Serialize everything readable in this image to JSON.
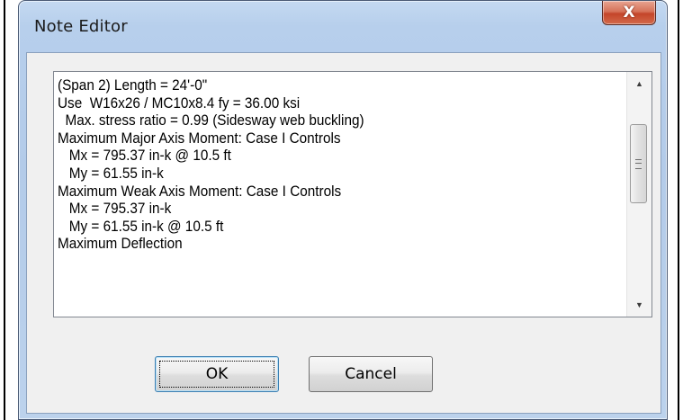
{
  "window": {
    "title": "Note Editor",
    "close_glyph": "X"
  },
  "memo": {
    "lines": [
      "(Span 2) Length = 24'-0\"",
      "Use  W16x26 / MC10x8.4 fy = 36.00 ksi",
      "  Max. stress ratio = 0.99 (Sidesway web buckling)",
      "Maximum Major Axis Moment: Case I Controls",
      "   Mx = 795.37 in-k @ 10.5 ft",
      "   My = 61.55 in-k",
      "Maximum Weak Axis Moment: Case I Controls",
      "   Mx = 795.37 in-k",
      "   My = 61.55 in-k @ 10.5 ft",
      "Maximum Deflection"
    ],
    "scroll_up_glyph": "▲",
    "scroll_down_glyph": "▼"
  },
  "buttons": {
    "ok_label": "OK",
    "cancel_label": "Cancel"
  },
  "icons": {
    "close": "close-icon",
    "scroll_up": "scroll-up-arrow-icon",
    "scroll_down": "scroll-down-arrow-icon",
    "grip": "scroll-grip-icon"
  },
  "colors": {
    "title_bar": "#b7cfec",
    "close_button": "#c4452a",
    "dialog_face": "#f0f0f0",
    "memo_background": "#ffffff"
  }
}
